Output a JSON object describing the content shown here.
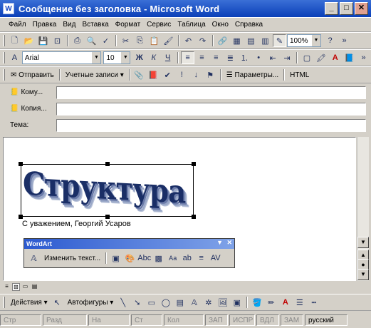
{
  "window": {
    "title": "Сообщение без заголовка - Microsoft Word",
    "icon": "word-doc-icon"
  },
  "menu": [
    "Файл",
    "Правка",
    "Вид",
    "Вставка",
    "Формат",
    "Сервис",
    "Таблица",
    "Окно",
    "Справка"
  ],
  "standard": {
    "zoom": "100%",
    "help": "?"
  },
  "formatting": {
    "font": "Arial",
    "size": "10",
    "bold": "Ж",
    "italic": "К",
    "underline": "Ч"
  },
  "mail": {
    "send": "Отправить",
    "accounts": "Учетные записи",
    "options": "Параметры...",
    "format": "HTML"
  },
  "address": {
    "to": "Кому...",
    "cc": "Копия...",
    "subject": "Тема:"
  },
  "document": {
    "wordart_text": "Структура книги",
    "signature": "С уважением, Георгий Усаров"
  },
  "wordart_toolbar": {
    "title": "WordArt",
    "edit": "Изменить текст...",
    "kerning": "Аа"
  },
  "draw": {
    "actions": "Действия",
    "autoshapes": "Автофигуры"
  },
  "status": [
    "Стр",
    "Разд",
    "На",
    "Ст",
    "Кол",
    "ЗАП",
    "ИСПР",
    "ВДЛ",
    "ЗАМ",
    "русский"
  ],
  "colors": {
    "title_bar": "#0a3fb8",
    "chrome": "#d4d0c8",
    "wordart": "#1a2e66"
  }
}
